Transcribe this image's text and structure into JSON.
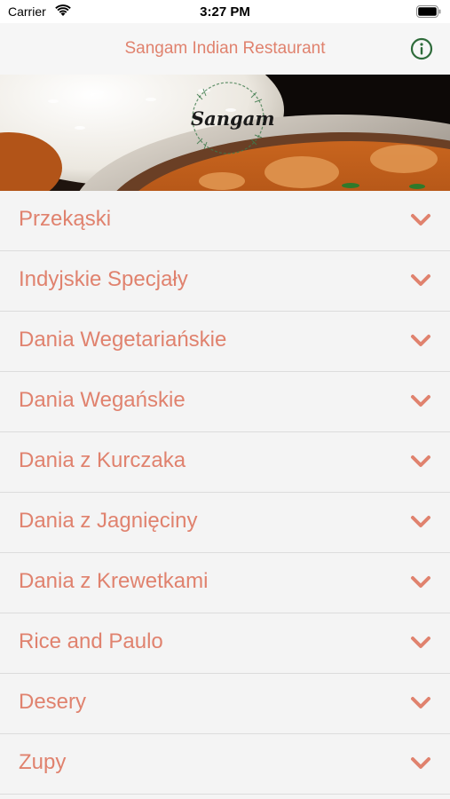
{
  "status_bar": {
    "carrier": "Carrier",
    "time": "3:27 PM"
  },
  "nav": {
    "title": "Sangam Indian Restaurant",
    "info_icon": "info-icon"
  },
  "hero": {
    "logo_text": "Sangam"
  },
  "menu": {
    "items": [
      {
        "label": "Przekąski"
      },
      {
        "label": "Indyjskie Specjały"
      },
      {
        "label": "Dania Wegetariańskie"
      },
      {
        "label": "Dania Wegańskie"
      },
      {
        "label": "Dania z Kurczaka"
      },
      {
        "label": "Dania z Jagnięciny"
      },
      {
        "label": "Dania z Krewetkami"
      },
      {
        "label": "Rice and Paulo"
      },
      {
        "label": "Desery"
      },
      {
        "label": "Zupy"
      }
    ]
  },
  "colors": {
    "accent": "#e0826e",
    "info_icon": "#2e6b3a",
    "row_background": "#f4f4f4",
    "separator": "#dcdcdc"
  }
}
